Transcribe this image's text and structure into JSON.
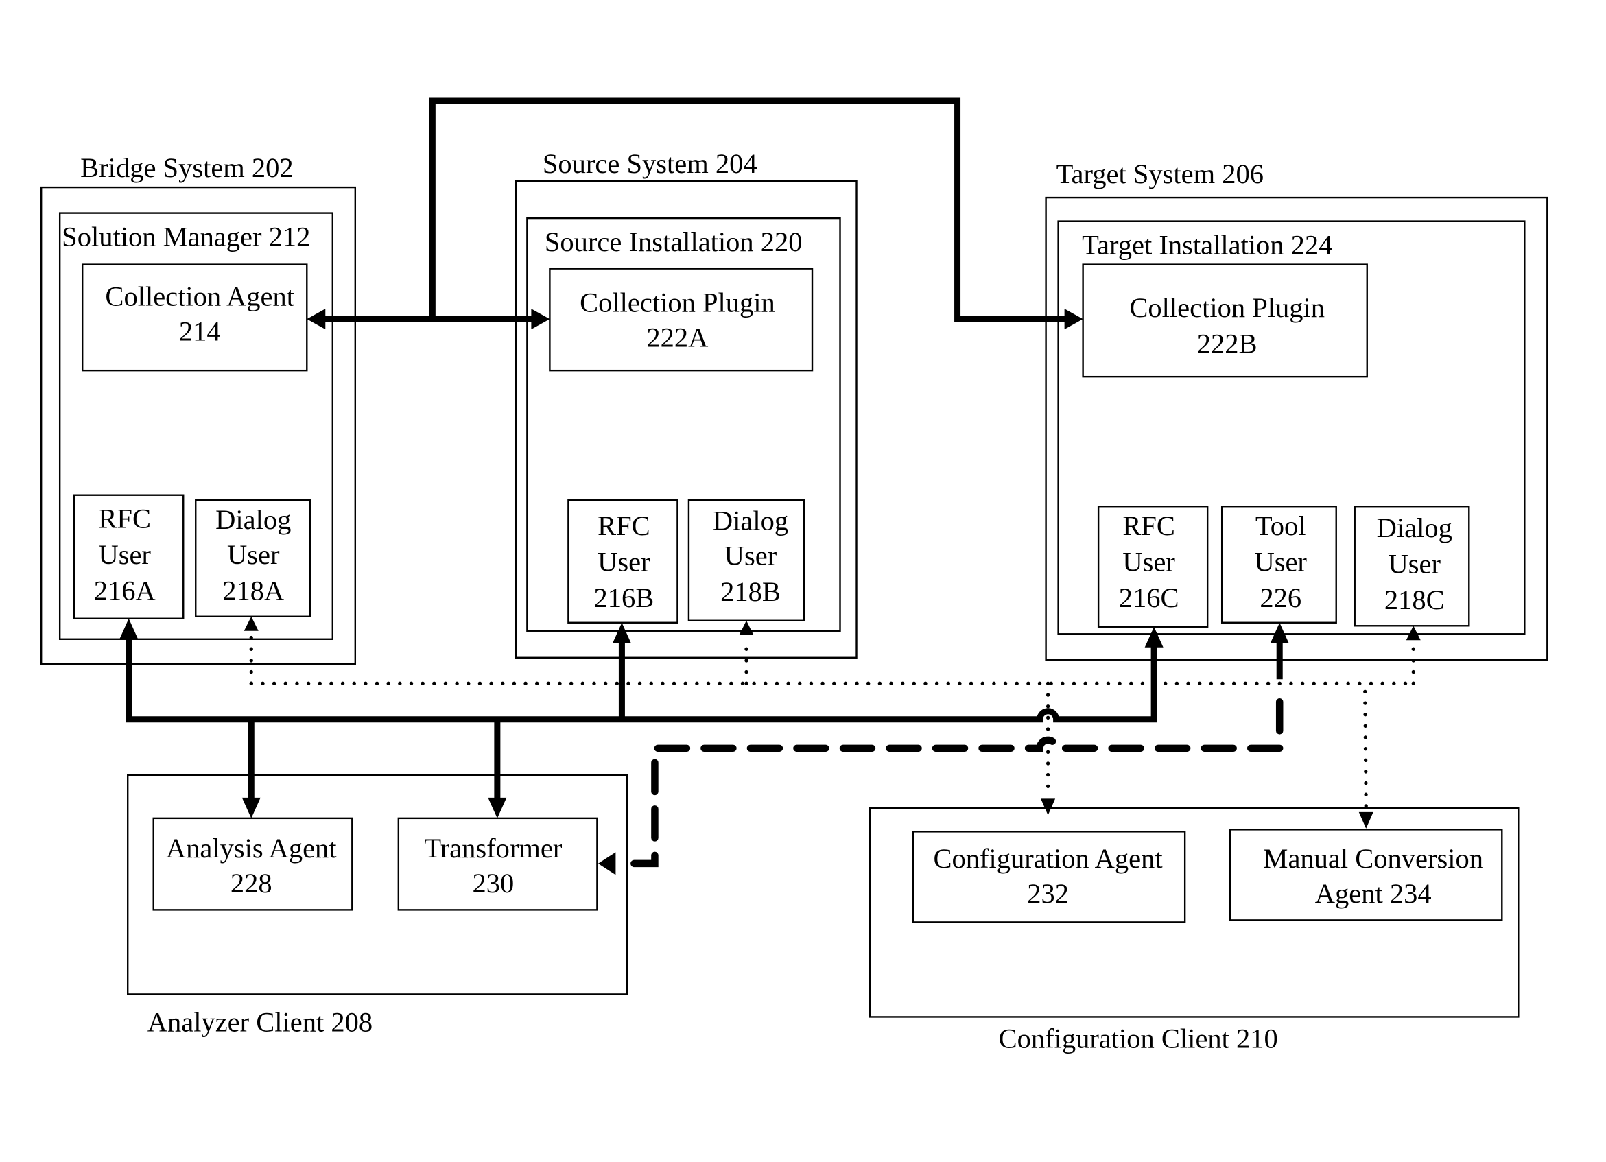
{
  "diagram": {
    "systems": {
      "bridge": {
        "title": "Bridge System 202",
        "solution_manager": "Solution Manager 212",
        "collection_agent": [
          "Collection Agent",
          "214"
        ],
        "rfc_user": [
          "RFC",
          "User",
          "216A"
        ],
        "dialog_user": [
          "Dialog",
          "User",
          "218A"
        ]
      },
      "source": {
        "title": "Source System 204",
        "installation": "Source Installation 220",
        "collection_plugin": [
          "Collection Plugin",
          "222A"
        ],
        "rfc_user": [
          "RFC",
          "User",
          "216B"
        ],
        "dialog_user": [
          "Dialog",
          "User",
          "218B"
        ]
      },
      "target": {
        "title": "Target System 206",
        "installation": "Target Installation 224",
        "collection_plugin": [
          "Collection Plugin",
          "222B"
        ],
        "rfc_user": [
          "RFC",
          "User",
          "216C"
        ],
        "tool_user": [
          "Tool",
          "User",
          "226"
        ],
        "dialog_user": [
          "Dialog",
          "User",
          "218C"
        ]
      }
    },
    "clients": {
      "analyzer": {
        "title": "Analyzer Client 208",
        "analysis_agent": [
          "Analysis Agent",
          "228"
        ],
        "transformer": [
          "Transformer",
          "230"
        ]
      },
      "configuration": {
        "title": "Configuration Client 210",
        "configuration_agent": [
          "Configuration Agent",
          "232"
        ],
        "manual_conversion_agent": [
          "Manual Conversion",
          "Agent 234"
        ]
      }
    },
    "connections": [
      {
        "from": "Collection Agent 214",
        "to": "Collection Plugin 222A",
        "style": "solid",
        "direction": "bidirectional"
      },
      {
        "from": "Collection Agent 214",
        "to": "Collection Plugin 222B",
        "style": "solid",
        "direction": "forward"
      },
      {
        "from": "Analyzer Client bus",
        "to": "RFC User 216A",
        "style": "solid"
      },
      {
        "from": "Analyzer Client bus",
        "to": "RFC User 216B",
        "style": "solid"
      },
      {
        "from": "Analyzer Client bus",
        "to": "RFC User 216C",
        "style": "solid"
      },
      {
        "from": "bus",
        "to": "Analysis Agent 228",
        "style": "solid"
      },
      {
        "from": "bus",
        "to": "Transformer 230",
        "style": "solid"
      },
      {
        "from": "Tool User 226",
        "to": "Transformer 230",
        "style": "dashed"
      },
      {
        "from": "Configuration Client",
        "to": "Dialog User 218A",
        "style": "dotted"
      },
      {
        "from": "Configuration Client",
        "to": "Dialog User 218B",
        "style": "dotted"
      },
      {
        "from": "Configuration Client",
        "to": "Dialog User 218C",
        "style": "dotted"
      },
      {
        "from": "dotted bus",
        "to": "Configuration Agent 232",
        "style": "dotted"
      },
      {
        "from": "dotted bus",
        "to": "Manual Conversion Agent 234",
        "style": "dotted"
      }
    ]
  }
}
